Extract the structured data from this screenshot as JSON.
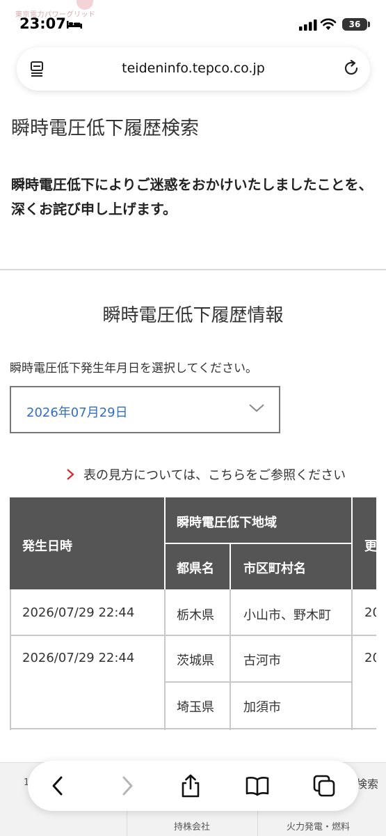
{
  "status_bar": {
    "brand_text": "東京電力パワーグリッド",
    "time": "23:07",
    "battery": "36"
  },
  "browser": {
    "url": "teideninfo.tepco.co.jp"
  },
  "page": {
    "title": "瞬時電圧低下履歴検索",
    "apology": "瞬時電圧低下によりご迷惑をおかけいたしましたことを、深くお詫び申し上げます。",
    "section_title": "瞬時電圧低下履歴情報",
    "select_label": "瞬時電圧低下発生年月日を選択してください。",
    "selected_date": "2026年07月29日",
    "howto_link": "表の見方については、こちらをご参照ください"
  },
  "table": {
    "headers": {
      "datetime": "発生日時",
      "area_group": "瞬時電圧低下地域",
      "prefecture": "都県名",
      "city": "市区町村名",
      "truncated": "更"
    },
    "rows": [
      {
        "datetime": "2026/07/29 22:44",
        "areas": [
          {
            "prefecture": "栃木県",
            "city": "小山市、野木町",
            "extra": "20"
          }
        ]
      },
      {
        "datetime": "2026/07/29 22:44",
        "areas": [
          {
            "prefecture": "茨城県",
            "city": "古河市",
            "extra": "20"
          },
          {
            "prefecture": "埼玉県",
            "city": "加須市",
            "extra": ""
          }
        ]
      }
    ]
  },
  "footer": {
    "partial_left": "1",
    "partial_search": "検索",
    "link_holding": "持株会社",
    "link_fuel": "火力発電・燃料"
  },
  "colors": {
    "header_bg": "#555555",
    "link_blue": "#2f6ec6",
    "arrow_red": "#d8262c"
  }
}
